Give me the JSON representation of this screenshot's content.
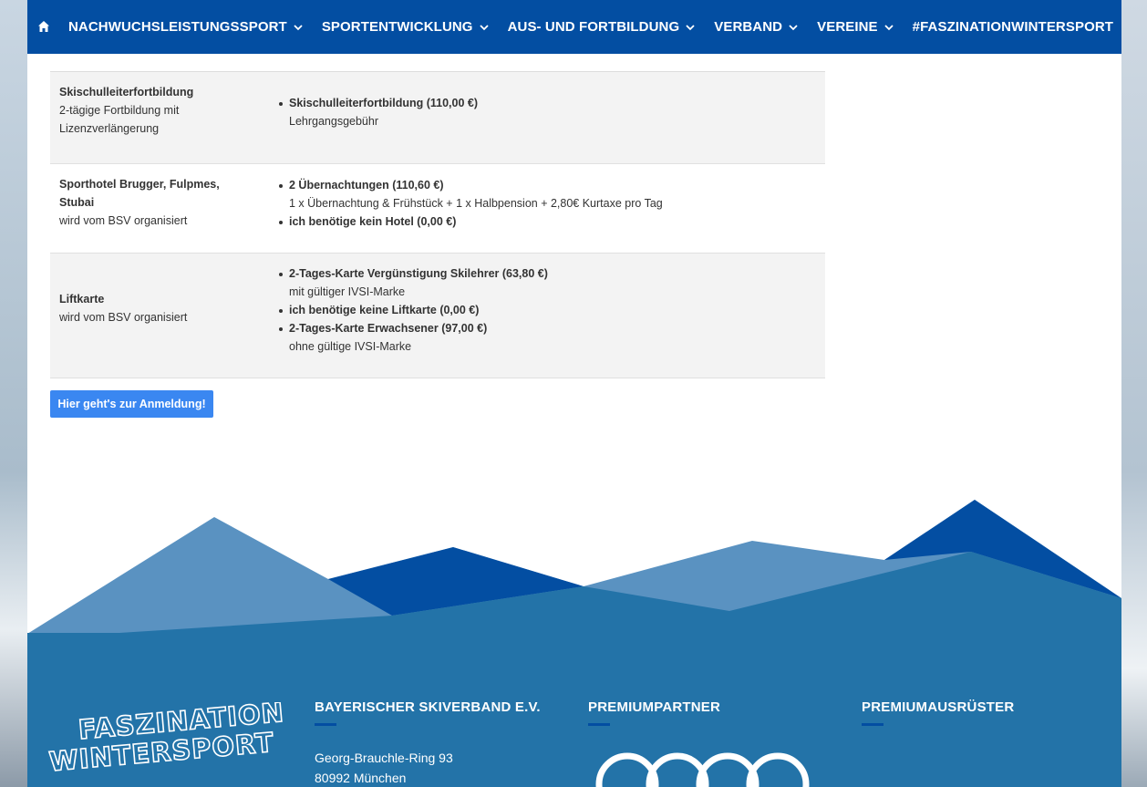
{
  "nav": {
    "items": [
      {
        "label": "NACHWUCHSLEISTUNGSSPORT",
        "has_dropdown": true
      },
      {
        "label": "SPORTENTWICKLUNG",
        "has_dropdown": true
      },
      {
        "label": "AUS- UND FORTBILDUNG",
        "has_dropdown": true
      },
      {
        "label": "VERBAND",
        "has_dropdown": true
      },
      {
        "label": "VEREINE",
        "has_dropdown": true
      },
      {
        "label": "#FASZINATIONWINTERSPORT",
        "has_dropdown": false
      }
    ]
  },
  "table": {
    "rows": [
      {
        "title": "Skischulleiterfortbildung",
        "subtitle": "2-tägige Fortbildung mit Lizenzverlängerung",
        "options": [
          {
            "label": "Skischulleiterfortbildung (110,00 €)",
            "desc": "Lehrgangsgebühr"
          }
        ]
      },
      {
        "title": "Sporthotel Brugger, Fulpmes, Stubai",
        "subtitle": "wird vom BSV organisiert",
        "options": [
          {
            "label": "2 Übernachtungen (110,60 €)",
            "desc": "1 x Übernachtung & Frühstück + 1 x Halbpension + 2,80€ Kurtaxe pro Tag"
          },
          {
            "label": "ich benötige kein Hotel (0,00 €)",
            "desc": ""
          }
        ]
      },
      {
        "title": "Liftkarte",
        "subtitle": "wird vom BSV organisiert",
        "options": [
          {
            "label": "2-Tages-Karte Vergünstigung Skilehrer (63,80 €)",
            "desc": "mit gültiger IVSI-Marke"
          },
          {
            "label": "ich benötige keine Liftkarte (0,00 €)",
            "desc": ""
          },
          {
            "label": "2-Tages-Karte Erwachsener (97,00 €)",
            "desc": "ohne gültige IVSI-Marke"
          }
        ]
      }
    ]
  },
  "register_button": "Hier geht's zur Anmeldung!",
  "footer": {
    "logo_text": [
      "FASZINATION",
      "WINTERSPORT"
    ],
    "col1": {
      "heading": "BAYERISCHER SKIVERBAND E.V.",
      "address": [
        "Georg-Brauchle-Ring 93",
        "80992 München"
      ]
    },
    "col2": {
      "heading": "PREMIUMPARTNER"
    },
    "col3": {
      "heading": "PREMIUMAUSRÜSTER"
    }
  },
  "colors": {
    "nav": "#034ea2",
    "footer": "#2373a8",
    "button": "#3a87f1",
    "row_shade": "#f3f3f3"
  },
  "icons": {
    "home": "home-icon",
    "dropdown": "chevron-down-icon",
    "partner_logo": "audi-rings-logo"
  }
}
